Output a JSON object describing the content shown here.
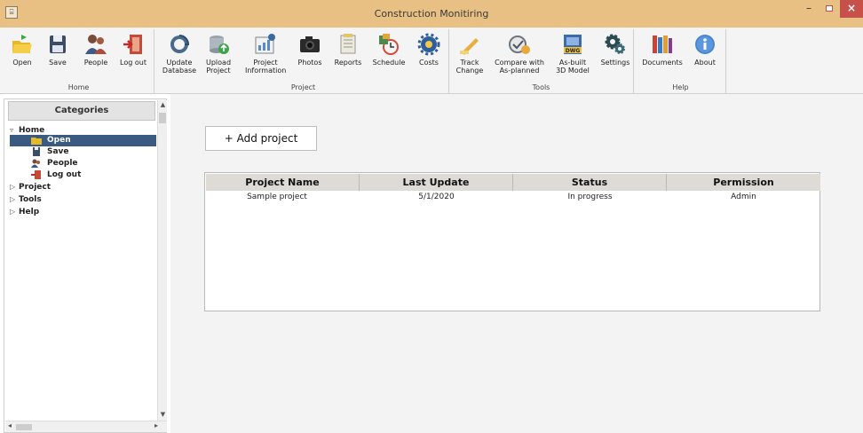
{
  "window": {
    "title": "Construction Monitiring",
    "min_symbol": "–",
    "close_symbol": "×"
  },
  "ribbon": {
    "groups": {
      "home": {
        "label": "Home",
        "buttons": {
          "open": "Open",
          "save": "Save",
          "people": "People",
          "logout": "Log out"
        }
      },
      "project": {
        "label": "Project",
        "buttons": {
          "update_db_1": "Update",
          "update_db_2": "Database",
          "upload_1": "Upload",
          "upload_2": "Project",
          "info_1": "Project",
          "info_2": "Information",
          "photos": "Photos",
          "reports": "Reports",
          "schedule": "Schedule",
          "costs": "Costs"
        }
      },
      "tools": {
        "label": "Tools",
        "buttons": {
          "track_1": "Track",
          "track_2": "Change",
          "compare_1": "Compare with",
          "compare_2": "As-planned",
          "asbuilt_1": "As-built",
          "asbuilt_2": "3D Model",
          "asbuilt_badge": "DWG",
          "settings": "Settings"
        }
      },
      "help": {
        "label": "Help",
        "buttons": {
          "documents": "Documents",
          "about": "About"
        }
      }
    }
  },
  "sidebar": {
    "header": "Categories",
    "tree": {
      "home": "Home",
      "open": "Open",
      "save": "Save",
      "people": "People",
      "logout": "Log out",
      "project": "Project",
      "tools": "Tools",
      "help": "Help"
    }
  },
  "main": {
    "add_project_label": "+ Add project",
    "table": {
      "headers": [
        "Project Name",
        "Last Update",
        "Status",
        "Permission"
      ],
      "rows": [
        [
          "Sample project",
          "5/1/2020",
          "In progress",
          "Admin"
        ]
      ]
    }
  },
  "colors": {
    "titlebar": "#e8c083",
    "close_button": "#c7504b",
    "selection": "#3a5a82",
    "table_header": "#dedbd6"
  }
}
